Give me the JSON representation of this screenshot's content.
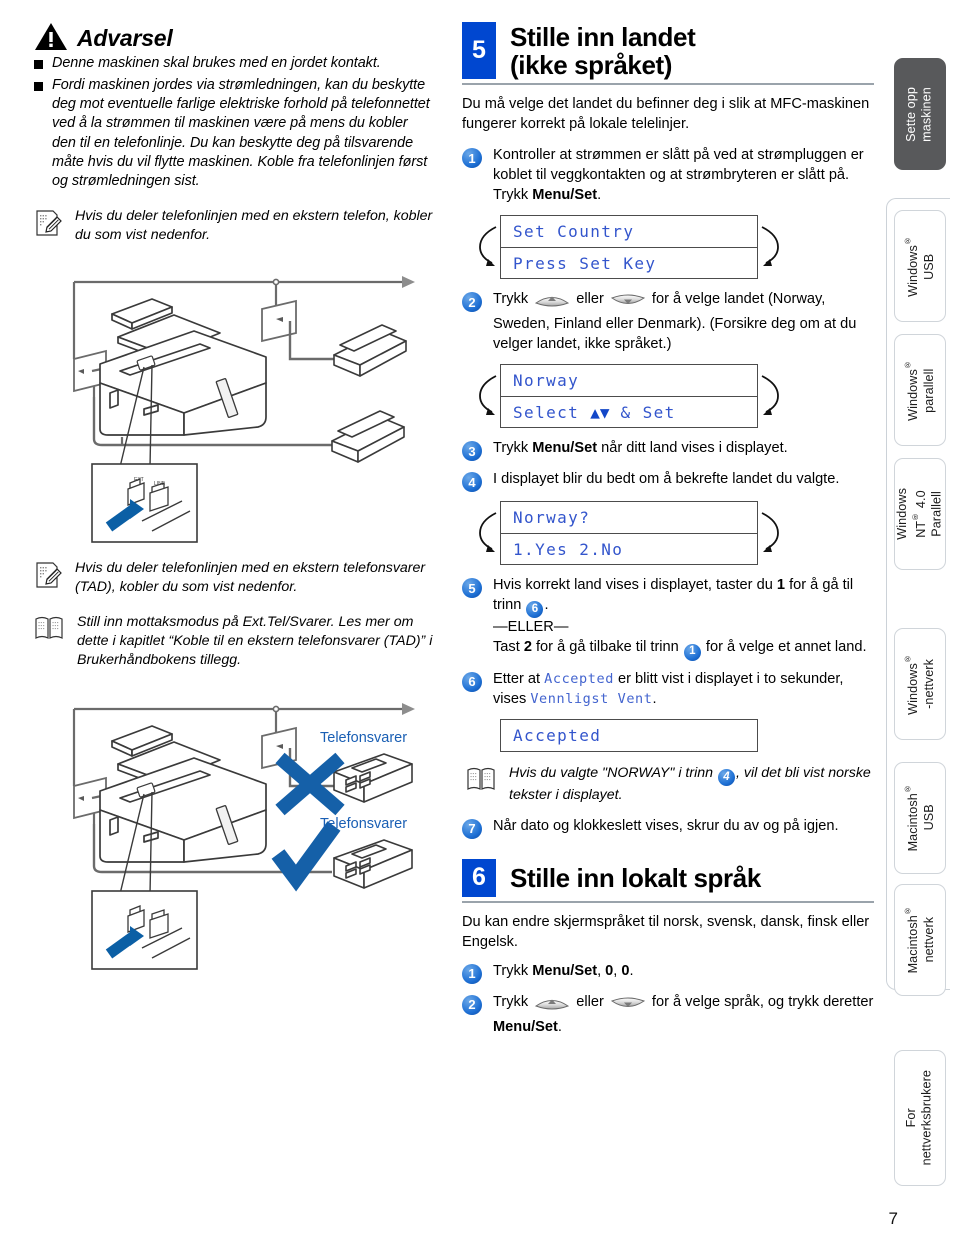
{
  "page": {
    "number": "7"
  },
  "warning": {
    "icon": "warning-triangle-icon",
    "title": "Advarsel",
    "bullets": [
      "Denne maskinen skal brukes med en jordet kontakt.",
      "Fordi maskinen jordes via strømledningen, kan du beskytte deg mot eventuelle farlige elektriske forhold på telefonnettet ved å la strømmen til maskinen være på mens du kobler den til en telefonlinje. Du kan beskytte deg på tilsvarende måte hvis du vil flytte maskinen. Koble fra telefonlinjen først og strømledningen sist."
    ]
  },
  "notes": {
    "note_phone": "Hvis du deler telefonlinjen med en ekstern telefon, kobler du som vist nedenfor.",
    "note_tad": "Hvis du deler telefonlinjen med en ekstern telefonsvarer (TAD), kobler du som vist nedenfor.",
    "note_manual": "Still inn mottaksmodus på Ext.Tel/Svarer. Les mer om dette i kapitlet “Koble til en ekstern telefonsvarer (TAD)” i Brukerhåndbokens tillegg.",
    "note_norway_pre": "Hvis du valgte \"NORWAY\" i trinn ",
    "note_norway_post": ", vil det bli vist norske tekster i displayet."
  },
  "illustration": {
    "label_tad_bad": "Telefonsvarer",
    "label_tad_good": "Telefonsvarer",
    "jack_ext": "EXT",
    "jack_line": "LINE"
  },
  "section5": {
    "number": "5",
    "title_line1": "Stille inn landet",
    "title_line2": "(ikke språket)",
    "lede": "Du må velge det landet du befinner deg i slik at MFC-maskinen fungerer korrekt på lokale telelinjer.",
    "steps": [
      {
        "n": "1",
        "pre": "Kontroller at strømmen er slått på ved at strømpluggen er koblet til veggkontakten og at strømbryteren er slått på. Trykk ",
        "bold": "Menu/Set",
        "post": "."
      },
      {
        "n": "2",
        "pre": "Trykk ",
        "mid": " eller ",
        "post": " for å velge landet (Norway, Sweden, Finland eller Denmark). (Forsikre deg om at du velger landet, ikke språket.)"
      },
      {
        "n": "3",
        "pre": "Trykk ",
        "bold": "Menu/Set",
        "post": " når ditt land vises i displayet."
      },
      {
        "n": "4",
        "pre": "I displayet blir du bedt om å bekrefte landet du valgte."
      },
      {
        "n": "5",
        "p1": "Hvis korrekt land vises i displayet, taster du ",
        "b1": "1",
        "p2": " for å gå til trinn ",
        "ref1": "6",
        "p3": ".",
        "or": "—ELLER—",
        "p4": "Tast ",
        "b2": "2",
        "p5": " for å gå tilbake til trinn ",
        "ref2": "1",
        "p6": " for å velge et annet land."
      },
      {
        "n": "6",
        "p1": "Etter at ",
        "lcd1": "Accepted",
        "p2": " er blitt vist i displayet i to sekunder, vises ",
        "lcd2": "Vennligst Vent",
        "p3": "."
      },
      {
        "n": "7",
        "pre": "Når dato og klokkeslett vises, skrur du av og på igjen."
      }
    ],
    "lcd1": {
      "line1": "Set Country",
      "line2": "Press Set Key"
    },
    "lcd2": {
      "line1": "Norway",
      "line2_pre": "Select ",
      "line2_arrows": "▲▼",
      "line2_post": " & Set"
    },
    "lcd3": {
      "line1": "Norway?",
      "line2": "1.Yes 2.No"
    },
    "lcd4": {
      "line1": "Accepted"
    }
  },
  "section6": {
    "number": "6",
    "title": "Stille inn lokalt språk",
    "lede": "Du kan endre skjermspråket til norsk, svensk, dansk, finsk eller Engelsk.",
    "steps": [
      {
        "n": "1",
        "pre": "Trykk ",
        "bold": "Menu/Set",
        "post": ", ",
        "bold2": "0",
        "post2": ", ",
        "bold3": "0",
        "post3": "."
      },
      {
        "n": "2",
        "pre": "Trykk ",
        "mid": " eller ",
        "post": " for å velge språk, og trykk deretter ",
        "bold": "Menu/Set",
        "post2": "."
      }
    ]
  },
  "rail": {
    "tabs": [
      {
        "id": "sette-opp-maskinen",
        "line1": "Sette opp",
        "line2": "maskinen",
        "active": true
      },
      {
        "id": "windows-usb",
        "line1": "Windows®",
        "line2": "USB",
        "active": false
      },
      {
        "id": "windows-parallell",
        "line1": "Windows®",
        "line2": "parallell",
        "active": false
      },
      {
        "id": "windows-nt40-parallell",
        "line1": "Windows",
        "line2": "NT® 4.0",
        "line3": "Parallell",
        "active": false
      },
      {
        "id": "windows-nettverk",
        "line1": "Windows®",
        "line2": "-nettverk",
        "active": false
      },
      {
        "id": "macintosh-usb",
        "line1": "Macintosh®",
        "line2": "USB",
        "active": false
      },
      {
        "id": "macintosh-nettverk",
        "line1": "Macintosh®",
        "line2": "nettverk",
        "active": false
      },
      {
        "id": "for-nettverksbrukere",
        "line1": "For",
        "line2": "nettverksbrukere",
        "active": false
      }
    ]
  },
  "colors": {
    "accent_blue": "#0047d0",
    "badge_blue": "#1d6fd4",
    "lcd_text": "#3355cc",
    "rule_gray": "#9aa3ab",
    "tab_active": "#58595b",
    "illus_blue": "#1a5fb4"
  }
}
